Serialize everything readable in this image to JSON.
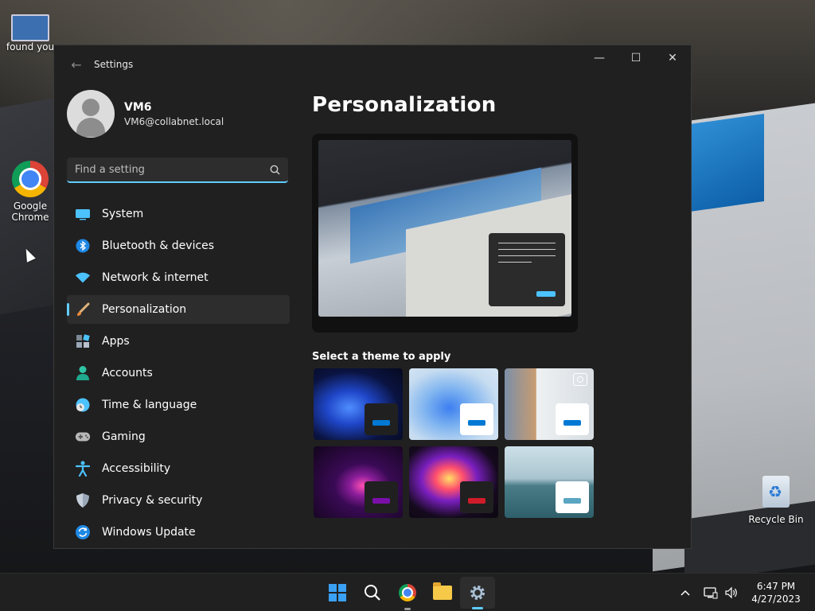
{
  "desktop": {
    "icons": [
      {
        "label": "found you",
        "icon": "folder-thumbnail"
      },
      {
        "label": "Google Chrome",
        "icon": "chrome-icon"
      },
      {
        "label": "Recycle Bin",
        "icon": "recycle-bin-icon"
      }
    ]
  },
  "window": {
    "title": "Settings",
    "controls": {
      "minimize": "—",
      "maximize": "☐",
      "close": "✕"
    }
  },
  "profile": {
    "name": "VM6",
    "email": "VM6@collabnet.local"
  },
  "search": {
    "placeholder": "Find a setting",
    "icon": "search-icon"
  },
  "nav": {
    "items": [
      {
        "label": "System",
        "icon": "display-icon",
        "color": "#4cc2ff"
      },
      {
        "label": "Bluetooth & devices",
        "icon": "bluetooth-icon",
        "color": "#1e88e5"
      },
      {
        "label": "Network & internet",
        "icon": "wifi-icon",
        "color": "#4cc2ff"
      },
      {
        "label": "Personalization",
        "icon": "paintbrush-icon",
        "color": "#f2a65a",
        "active": true
      },
      {
        "label": "Apps",
        "icon": "apps-icon",
        "color": "#9aa7b6"
      },
      {
        "label": "Accounts",
        "icon": "person-icon",
        "color": "#2ec4a6"
      },
      {
        "label": "Time & language",
        "icon": "globe-clock-icon",
        "color": "#4cc2ff"
      },
      {
        "label": "Gaming",
        "icon": "gamepad-icon",
        "color": "#b8b8b8"
      },
      {
        "label": "Accessibility",
        "icon": "accessibility-icon",
        "color": "#4cc2ff"
      },
      {
        "label": "Privacy & security",
        "icon": "shield-icon",
        "color": "#9aa7b6"
      },
      {
        "label": "Windows Update",
        "icon": "sync-icon",
        "color": "#1e88e5"
      }
    ]
  },
  "content": {
    "title": "Personalization",
    "theme_heading": "Select a theme to apply",
    "themes": [
      {
        "name": "theme-dark-bloom",
        "accent": "#0078d4",
        "swatch_bg": "#202020"
      },
      {
        "name": "theme-light-bloom",
        "accent": "#0078d4",
        "swatch_bg": "#ffffff"
      },
      {
        "name": "theme-spotlight",
        "accent": "#0078d4",
        "swatch_bg": "#ffffff"
      },
      {
        "name": "theme-glow",
        "accent": "#7a0fa8",
        "swatch_bg": "#202020"
      },
      {
        "name": "theme-captured-motion",
        "accent": "#d01c2a",
        "swatch_bg": "#202020"
      },
      {
        "name": "theme-flow",
        "accent": "#5aa6c2",
        "swatch_bg": "#ffffff"
      }
    ]
  },
  "taskbar": {
    "apps": [
      "start-icon",
      "search-icon",
      "chrome-icon",
      "file-explorer-icon",
      "settings-icon"
    ],
    "time": "6:47 PM",
    "date": "4/27/2023",
    "tray": [
      "chevron-up-icon",
      "network-icon",
      "volume-icon"
    ]
  }
}
